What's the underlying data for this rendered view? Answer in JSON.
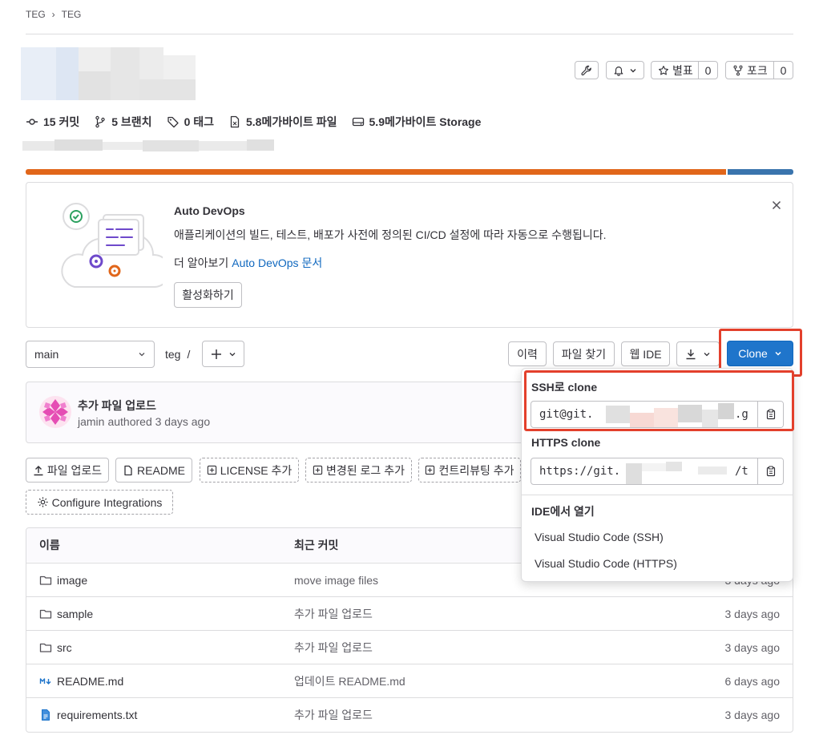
{
  "breadcrumb": {
    "items": [
      "TEG",
      "TEG"
    ],
    "separator": "›"
  },
  "header": {
    "star_label": "별표",
    "star_count": "0",
    "fork_label": "포크",
    "fork_count": "0"
  },
  "stats": {
    "commits": "15 커밋",
    "branches": "5 브랜치",
    "tags": "0 태그",
    "files": "5.8메가바이트 파일",
    "storage": "5.9메가바이트 Storage"
  },
  "language_bar": {
    "primary_color": "#e1661a",
    "primary_fraction": 0.912,
    "secondary_color": "#3a74ad"
  },
  "devops": {
    "title": "Auto DevOps",
    "description": "애플리케이션의 빌드, 테스트, 배포가 사전에 정의된 CI/CD 설정에 따라 자동으로 수행됩니다.",
    "learn_more_prefix": "더 알아보기",
    "learn_more_link": "Auto DevOps 문서",
    "enable_button": "활성화하기"
  },
  "toolbar": {
    "branch": "main",
    "path": "teg",
    "path_separator": "/",
    "history": "이력",
    "find_file": "파일 찾기",
    "web_ide": "웹 IDE",
    "clone": "Clone"
  },
  "last_commit": {
    "title": "추가 파일 업로드",
    "author": "jamin",
    "meta": "authored 3 days ago"
  },
  "actions": {
    "upload": "파일 업로드",
    "readme": "README",
    "license": "LICENSE 추가",
    "changelog": "변경된 로그 추가",
    "contributing": "컨트리뷰팅 추가",
    "configure": "Configure Integrations"
  },
  "files": {
    "headers": {
      "name": "이름",
      "commit": "최근 커밋"
    },
    "rows": [
      {
        "name": "image",
        "type": "folder",
        "commit": "move image files",
        "time": "3 days ago"
      },
      {
        "name": "sample",
        "type": "folder",
        "commit": "추가 파일 업로드",
        "time": "3 days ago"
      },
      {
        "name": "src",
        "type": "folder",
        "commit": "추가 파일 업로드",
        "time": "3 days ago"
      },
      {
        "name": "README.md",
        "type": "markdown",
        "commit": "업데이트 README.md",
        "time": "6 days ago"
      },
      {
        "name": "requirements.txt",
        "type": "text",
        "commit": "추가 파일 업로드",
        "time": "3 days ago"
      }
    ]
  },
  "clone_dropdown": {
    "ssh_title": "SSH로 clone",
    "ssh_url_start": "git@git.",
    "ssh_url_end": ".g",
    "https_title": "HTTPS clone",
    "https_url_start": "https://git.",
    "https_url_end": "/t",
    "ide_title": "IDE에서 열기",
    "ide_options": [
      "Visual Studio Code (SSH)",
      "Visual Studio Code (HTTPS)"
    ]
  },
  "colors": {
    "accent": "#1f75cb",
    "link": "#1068bf",
    "highlight": "#e3402c"
  }
}
